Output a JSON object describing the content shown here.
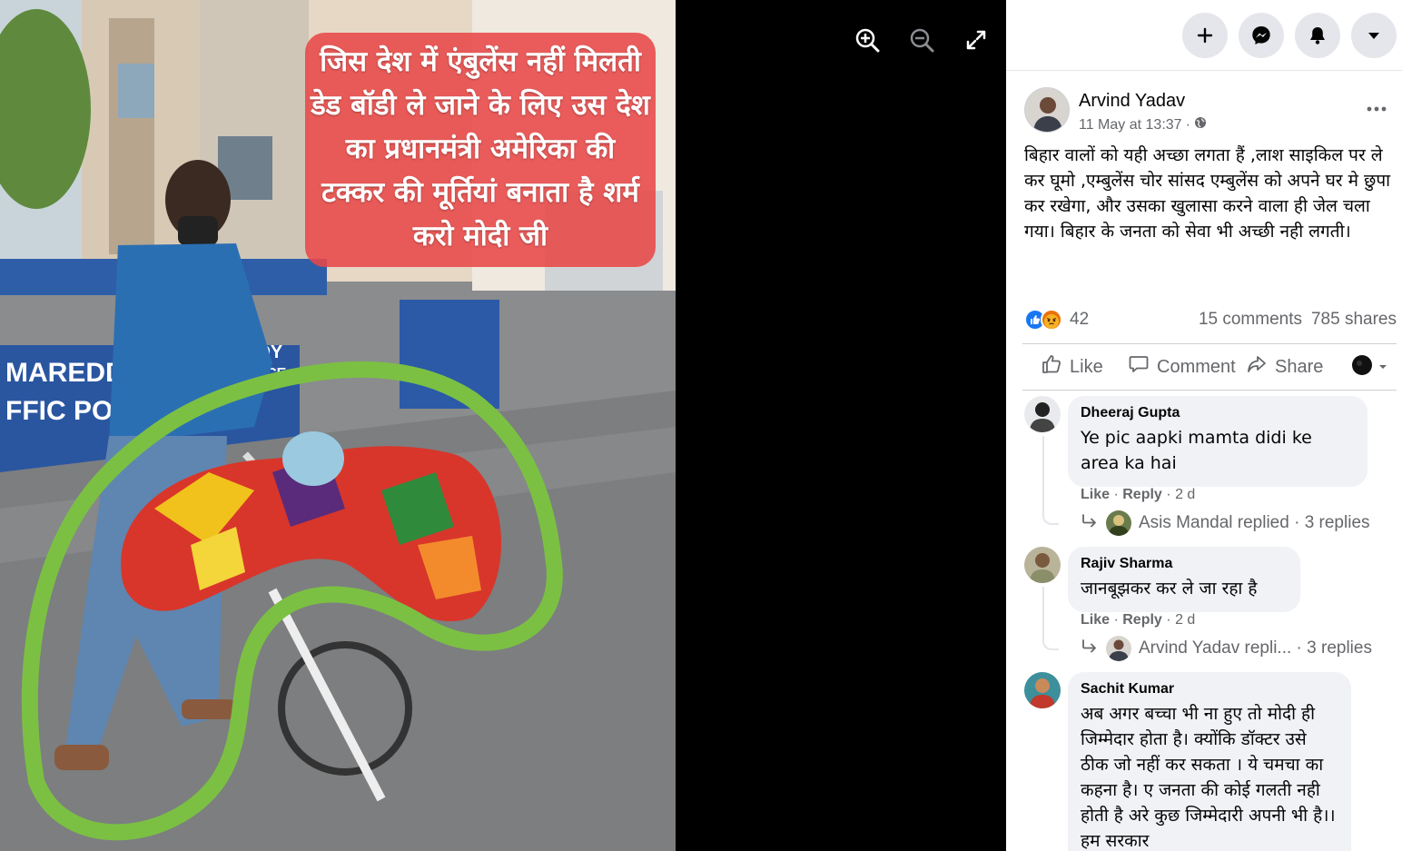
{
  "viewer": {
    "image_caption": "जिस देश में एंबुलेंस नहीं मिलती डेड बॉडी ले जाने के लिए उस देश का प्रधानमंत्री अमेरिका की टक्कर की मूर्तियां बनाता है शर्म करो मोदी जी",
    "controls": [
      {
        "name": "zoom-in-icon"
      },
      {
        "name": "zoom-out-icon"
      },
      {
        "name": "fullscreen-icon"
      }
    ]
  },
  "topbar": {
    "buttons": [
      "plus-icon",
      "messenger-icon",
      "bell-icon",
      "caret-down-icon"
    ]
  },
  "post": {
    "author": "Arvind Yadav",
    "timestamp": "11 May at 13:37",
    "separator": "·",
    "audience_icon": "globe-icon",
    "text": "बिहार वालों को यही अच्छा लगता हैं ,लाश साइकिल पर ले कर घूमो ,एम्बुलेंस चोर सांसद एम्बुलेंस को अपने घर मे छुपा कर रखेगा, और उसका खुलासा करने वाला ही जेल चला गया। बिहार के जनता को सेवा भी अच्छी नही लगती।",
    "reaction_count": "42",
    "comments": "15 comments",
    "shares": "785 shares",
    "actions": {
      "like": "Like",
      "comment": "Comment",
      "share": "Share"
    }
  },
  "comments": [
    {
      "name": "Dheeraj Gupta",
      "text": "Ye pic aapki mamta didi ke area ka hai",
      "like": "Like",
      "reply": "Reply",
      "sep": "·",
      "age": "2 d",
      "replies_text": "Asis Mandal replied · 3 replies"
    },
    {
      "name": "Rajiv Sharma",
      "text": "जानबूझकर कर ले जा रहा है",
      "like": "Like",
      "reply": "Reply",
      "sep": "·",
      "age": "2 d",
      "replies_text": "Arvind Yadav repli... · 3 replies"
    },
    {
      "name": "Sachit Kumar",
      "text": "अब अगर बच्चा भी ना हुए तो मोदी ही जिम्मेदार होता है। क्योंकि डॉक्टर उसे ठीक जो नहीं कर सकता । ये चमचा का कहना है। ए जनता की कोई गलती नही होती है अरे कुछ जिम्मेदारी अपनी भी है।। हम सरकार"
    }
  ],
  "colors": {
    "fb_blue": "#1877f2",
    "highlight_green": "#7bc043",
    "caption_red": "#e84848"
  }
}
